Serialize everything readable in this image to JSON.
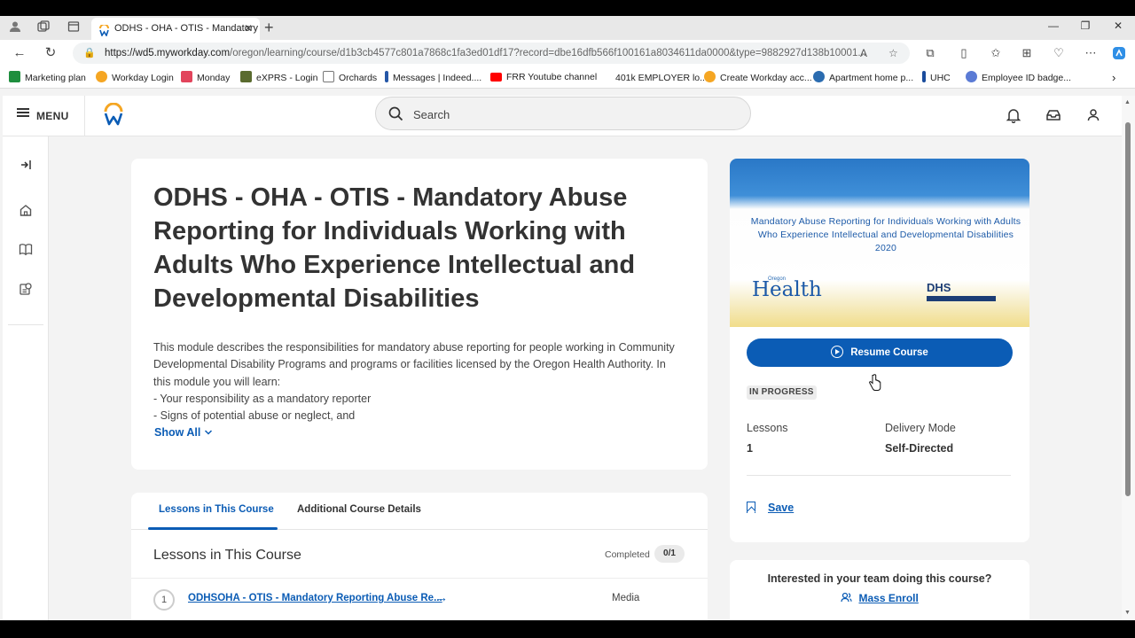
{
  "browser": {
    "tab_title": "ODHS - OHA - OTIS - Mandatory",
    "url_host": "https://wd5.myworkday.com",
    "url_path": "/oregon/learning/course/d1b3cb4577c801a7868c1fa3ed01df17?record=dbe16dfb566f100161a8034611da0000&type=9882927d138b10001..."
  },
  "bookmarks": [
    {
      "label": "Marketing plan",
      "color": "#1e8e3e"
    },
    {
      "label": "Workday Login",
      "color": "#f5a623"
    },
    {
      "label": "Monday",
      "color": "#e2445c"
    },
    {
      "label": "eXPRS - Login",
      "color": "#5a6b2f"
    },
    {
      "label": "Orchards",
      "color": "#777777"
    },
    {
      "label": "Messages | Indeed....",
      "color": "#2557a7"
    },
    {
      "label": "FRR Youtube channel",
      "color": "#ff0000"
    },
    {
      "label": "401k EMPLOYER lo...",
      "color": "#ffffff"
    },
    {
      "label": "Create Workday acc...",
      "color": "#f5a623"
    },
    {
      "label": "Apartment home p...",
      "color": "#2b6cb0"
    },
    {
      "label": "UHC",
      "color": "#1a4c9c"
    },
    {
      "label": "Employee ID badge...",
      "color": "#5b7bd5"
    }
  ],
  "header": {
    "menu_label": "MENU",
    "search_placeholder": "Search"
  },
  "course": {
    "title": "ODHS - OHA - OTIS - Mandatory Abuse Reporting for Individuals Working with Adults Who Experience Intellectual and Developmental Disabilities",
    "description": [
      "This module describes the responsibilities for mandatory abuse reporting for people working in Community Developmental Disability Programs and programs or facilities licensed by the Oregon Health Authority. In this module you will learn:",
      "- Your responsibility as a mandatory reporter",
      "- Signs of potential abuse or neglect, and"
    ],
    "show_all": "Show All"
  },
  "tabs": [
    {
      "label": "Lessons in This Course",
      "active": true
    },
    {
      "label": "Additional Course Details",
      "active": false
    }
  ],
  "lessons": {
    "heading": "Lessons in This Course",
    "completed_label": "Completed",
    "completed_count": "0/1",
    "items": [
      {
        "number": "1",
        "title": "ODHSOHA - OTIS - Mandatory Reporting Abuse Re...",
        "type": "Media"
      }
    ]
  },
  "sidebar_card": {
    "banner_title": "Mandatory Abuse Reporting for Individuals Working  with Adults Who Experience Intellectual and Developmental Disabilities  2020",
    "banner_logo_left": "Health",
    "banner_logo_left_small": "Oregon",
    "banner_logo_right": "DHS",
    "resume_label": "Resume Course",
    "status": "IN PROGRESS",
    "lessons_label": "Lessons",
    "lessons_value": "1",
    "delivery_label": "Delivery Mode",
    "delivery_value": "Self-Directed",
    "save_label": "Save"
  },
  "team_card": {
    "question": "Interested in your team doing this course?",
    "mass_enroll": "Mass Enroll"
  },
  "colors": {
    "accent": "#0b5cb5",
    "logo_orange": "#f5a623",
    "logo_blue": "#0b5cb5"
  }
}
